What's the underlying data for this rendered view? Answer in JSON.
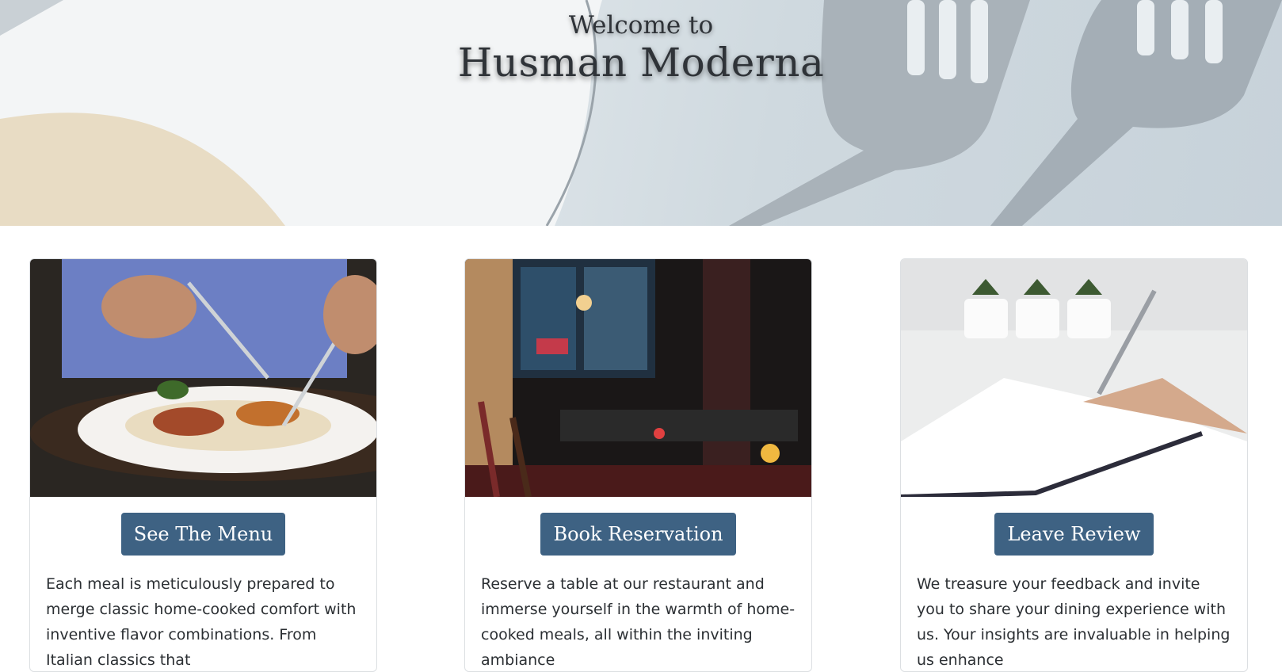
{
  "hero": {
    "subtitle": "Welcome to",
    "title": "Husman Moderna",
    "image_icon": "napkin-and-forks-image"
  },
  "cards": [
    {
      "image_icon": "pasta-dish-image",
      "button_label": "See The Menu",
      "description": "Each meal is meticulously prepared to merge classic home-cooked comfort with inventive flavor combinations. From Italian classics that"
    },
    {
      "image_icon": "restaurant-interior-image",
      "button_label": "Book Reservation",
      "description": "Reserve a table at our restaurant and immerse yourself in the warmth of home-cooked meals, all within the inviting ambiance"
    },
    {
      "image_icon": "writing-notebook-image",
      "button_label": "Leave Review",
      "description": "We treasure your feedback and invite you to share your dining experience with us. Your insights are invaluable in helping us enhance"
    }
  ],
  "colors": {
    "button": "#3e6283",
    "button_text": "#ffffff",
    "heading_text": "#2f3338",
    "body_text": "#2b2f33"
  }
}
